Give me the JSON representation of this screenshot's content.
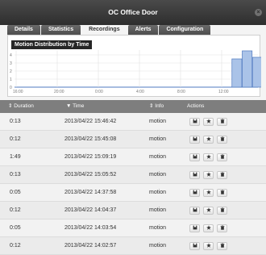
{
  "window": {
    "title": "OC Office Door"
  },
  "tabs": [
    {
      "label": "Details",
      "active": false
    },
    {
      "label": "Statistics",
      "active": false
    },
    {
      "label": "Recordings",
      "active": true
    },
    {
      "label": "Alerts",
      "active": false
    },
    {
      "label": "Configuration",
      "active": false
    }
  ],
  "chart_data": {
    "type": "bar",
    "title": "Motion Distribution by Time",
    "xlabel": "",
    "ylabel": "",
    "x_ticks": [
      "16:00",
      "20:00",
      "0:00",
      "4:00",
      "8:00",
      "12:00"
    ],
    "y_ticks": [
      "0",
      "1",
      "2",
      "3",
      "4"
    ],
    "ylim": [
      0,
      4.6
    ],
    "grid": true,
    "bar_color": "#aac3e8",
    "series": [
      {
        "values": [
          {
            "x": "12:00-13:00",
            "y": 0
          },
          {
            "x": "13:00-14:00",
            "y": 3.5
          },
          {
            "x": "14:00-15:00",
            "y": 4.5
          },
          {
            "x": "15:00-16:00",
            "y": 3.7
          }
        ]
      }
    ]
  },
  "table": {
    "header": {
      "duration": "Duration",
      "time": "Time",
      "info": "Info",
      "actions": "Actions"
    },
    "rows": [
      {
        "duration": "0:13",
        "time": "2013/04/22 15:46:42",
        "info": "motion"
      },
      {
        "duration": "0:12",
        "time": "2013/04/22 15:45:08",
        "info": "motion"
      },
      {
        "duration": "1:49",
        "time": "2013/04/22 15:09:19",
        "info": "motion"
      },
      {
        "duration": "0:13",
        "time": "2013/04/22 15:05:52",
        "info": "motion"
      },
      {
        "duration": "0:05",
        "time": "2013/04/22 14:37:58",
        "info": "motion"
      },
      {
        "duration": "0:12",
        "time": "2013/04/22 14:04:37",
        "info": "motion"
      },
      {
        "duration": "0:05",
        "time": "2013/04/22 14:03:54",
        "info": "motion"
      },
      {
        "duration": "0:12",
        "time": "2013/04/22 14:02:57",
        "info": "motion"
      }
    ]
  },
  "icons": {
    "sort": "sort-icon",
    "download": "save-icon",
    "favorite": "star-icon",
    "delete": "trash-icon"
  }
}
